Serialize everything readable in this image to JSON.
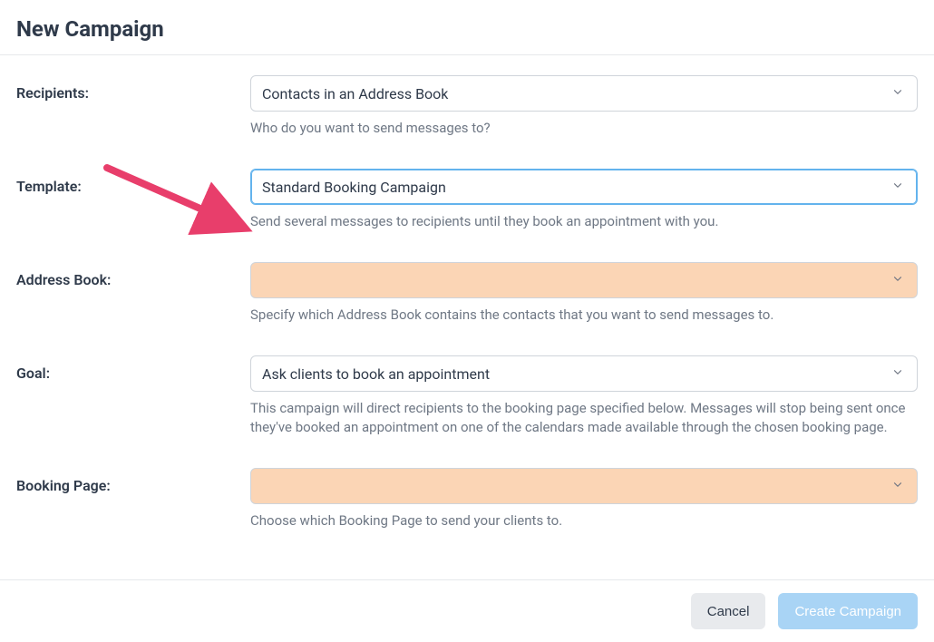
{
  "header": {
    "title": "New Campaign"
  },
  "fields": {
    "recipients": {
      "label": "Recipients:",
      "value": "Contacts in an Address Book",
      "help": "Who do you want to send messages to?"
    },
    "template": {
      "label": "Template:",
      "value": "Standard Booking Campaign",
      "help": "Send several messages to recipients until they book an appointment with you."
    },
    "addressBook": {
      "label": "Address Book:",
      "value": "",
      "help": "Specify which Address Book contains the contacts that you want to send messages to."
    },
    "goal": {
      "label": "Goal:",
      "value": "Ask clients to book an appointment",
      "help": "This campaign will direct recipients to the booking page specified below. Messages will stop being sent once they've booked an appointment on one of the calendars made available through the chosen booking page."
    },
    "bookingPage": {
      "label": "Booking Page:",
      "value": "",
      "help": "Choose which Booking Page to send your clients to."
    }
  },
  "footer": {
    "cancel": "Cancel",
    "create": "Create Campaign"
  },
  "annotation": {
    "arrowColor": "#e83e6b"
  }
}
